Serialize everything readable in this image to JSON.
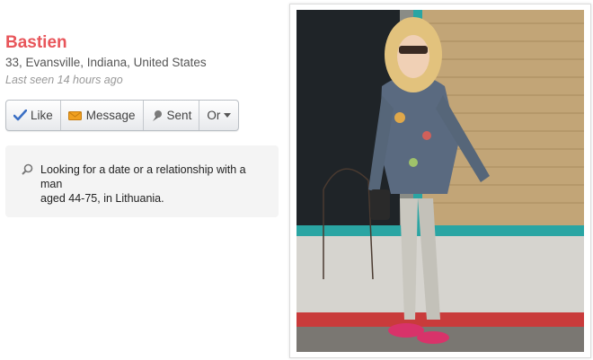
{
  "profile": {
    "name": "Bastien",
    "location": "33, Evansville, Indiana, United States",
    "last_seen": "Last seen 14 hours ago"
  },
  "actions": {
    "like": "Like",
    "message": "Message",
    "sent": "Sent",
    "or": "Or"
  },
  "looking_for": {
    "text": "Looking for a date or a relationship with a man\naged 44-75, in Lithuania."
  },
  "colors": {
    "name": "#e8555a",
    "check": "#3a6fc4",
    "envelope": "#f0a020"
  }
}
